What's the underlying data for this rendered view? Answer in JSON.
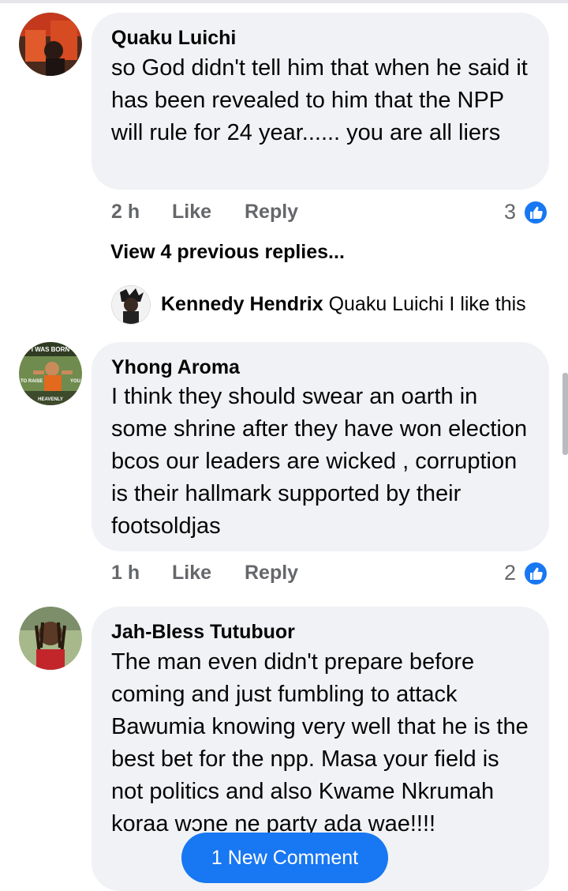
{
  "comments": [
    {
      "author": "Quaku Luichi",
      "text": "so God didn't tell him that when he said it has been revealed to him that the NPP will rule for 24 year...... you are all liers",
      "time": "2 h",
      "like_label": "Like",
      "reply_label": "Reply",
      "reactions": "3",
      "view_previous": "View 4 previous replies...",
      "reply": {
        "author": "Kennedy Hendrix",
        "text": "Quaku Luichi I like this"
      }
    },
    {
      "author": "Yhong Aroma",
      "text": "I think they should swear an oarth in some shrine after they have won election bcos our leaders are wicked , corruption is their hallmark supported by their footsoldjas",
      "time": "1 h",
      "like_label": "Like",
      "reply_label": "Reply",
      "reactions": "2",
      "avatar_text": {
        "top": "I WAS BORN",
        "left": "TO RAISE",
        "right": "YOU",
        "bottom": "HEAVENLY"
      }
    },
    {
      "author": "Jah-Bless Tutubuor",
      "text": "The man even didn't prepare before coming and just fumbling to attack Bawumia knowing very well that he is the best bet for the npp. Masa your field is not politics and also Kwame Nkrumah koraa wɔne ne party ada wae!!!!"
    }
  ],
  "new_comment_button": "1 New Comment",
  "colors": {
    "bubble": "#f0f2f5",
    "meta": "#65676b",
    "accent": "#1877f2"
  },
  "icons": {
    "reaction": "thumbs-up-icon"
  }
}
